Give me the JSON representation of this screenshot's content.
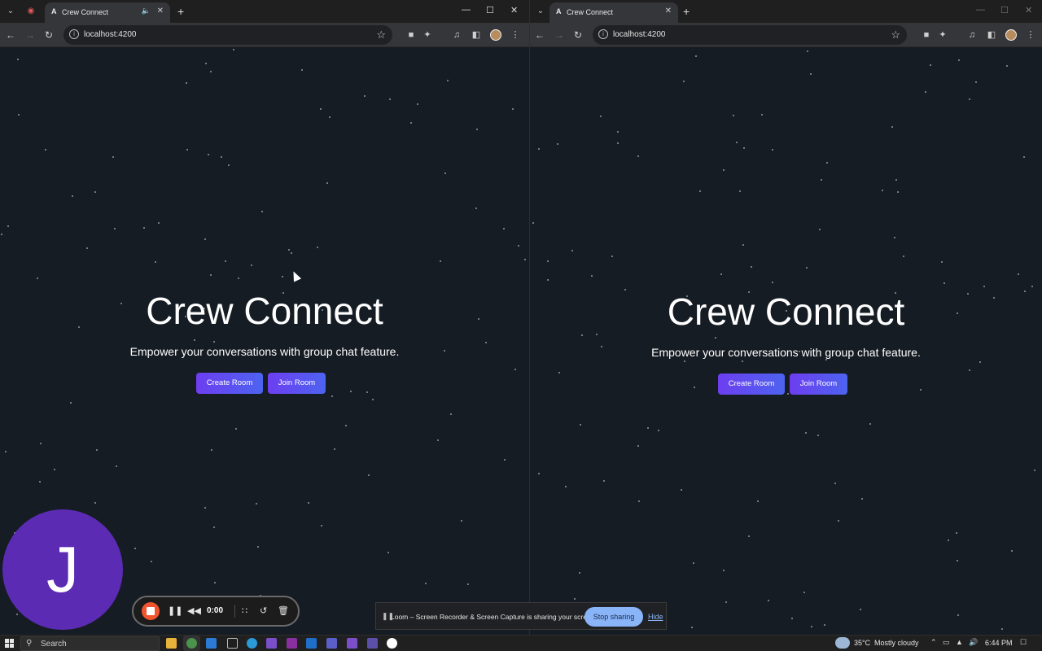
{
  "browser": {
    "tab_title": "Crew Connect",
    "tab_favicon": "A",
    "url": "localhost:4200"
  },
  "page": {
    "title": "Crew Connect",
    "subtitle": "Empower your conversations with group chat feature.",
    "create_button": "Create Room",
    "join_button": "Join Room"
  },
  "loom": {
    "avatar_letter": "J",
    "timer": "0:00",
    "sharing_text": "Loom – Screen Recorder & Screen Capture is sharing your screen.",
    "stop_sharing": "Stop sharing",
    "hide": "Hide"
  },
  "taskbar": {
    "search_placeholder": "Search",
    "temperature": "35°C",
    "weather": "Mostly cloudy",
    "time": "6:44 PM"
  },
  "colors": {
    "background": "#161c24",
    "button_gradient_start": "#6d3ef0",
    "button_gradient_end": "#4d63f0",
    "recorder_stop": "#f2542d",
    "stop_sharing_bg": "#8ab4f8"
  }
}
